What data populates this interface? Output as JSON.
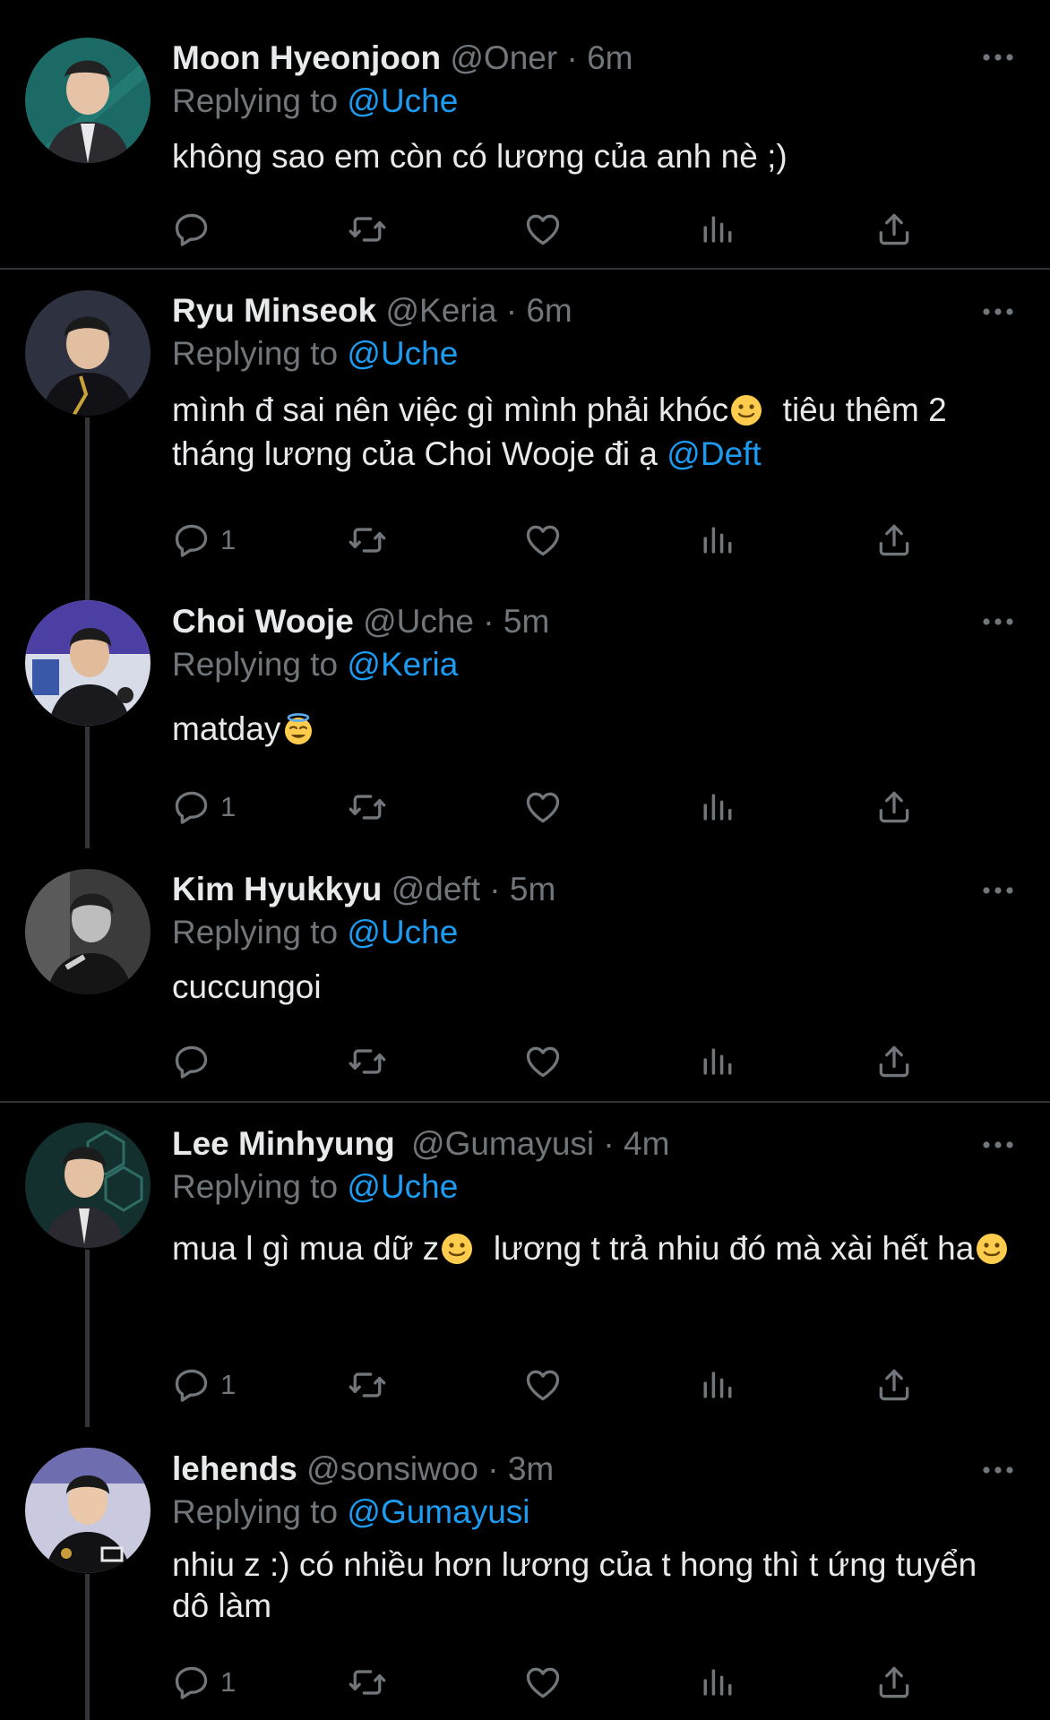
{
  "tweets": [
    {
      "name": "Moon Hyeonjoon",
      "handle": "@Oner",
      "sep": "·",
      "time": "6m",
      "replying_prefix": "Replying to",
      "replying_to": "@Uche",
      "body_text": "không sao em còn có lương của anh nè ;)",
      "reply_count": "",
      "avatar_color": "#2a6f6a"
    },
    {
      "name": "Ryu Minseok",
      "handle": "@Keria",
      "sep": "·",
      "time": "6m",
      "replying_prefix": "Replying to",
      "replying_to": "@Uche",
      "body_part1": "mình đ sai nên việc gì mình phải khóc",
      "body_part2": "  tiêu thêm 2 tháng lương của Choi Wooje đi ạ ",
      "body_mention": "@Deft",
      "reply_count": "1",
      "avatar_color": "#3a3d48"
    },
    {
      "name": "Choi Wooje",
      "handle": "@Uche",
      "sep": "·",
      "time": "5m",
      "replying_prefix": "Replying to",
      "replying_to": "@Keria",
      "body_text": "matday",
      "reply_count": "1",
      "avatar_color": "#4a4aa8"
    },
    {
      "name": "Kim Hyukkyu",
      "handle": "@deft",
      "sep": "·",
      "time": "5m",
      "replying_prefix": "Replying to",
      "replying_to": "@Uche",
      "body_text": "cuccungoi",
      "reply_count": "",
      "avatar_color": "#555555"
    },
    {
      "name": "Lee Minhyung",
      "handle": "@Gumayusi",
      "sep": "·",
      "time": "4m",
      "replying_prefix": "Replying to",
      "replying_to": "@Uche",
      "body_part1": "mua l gì mua dữ z",
      "body_part2": "  lương t trả nhiu đó mà xài hết ha",
      "reply_count": "1",
      "avatar_color": "#1f3a3a"
    },
    {
      "name": "lehends",
      "handle": "@sonsiwoo",
      "sep": "·",
      "time": "3m",
      "replying_prefix": "Replying to",
      "replying_to": "@Gumayusi",
      "body_text": "nhiu z :) có nhiều hơn lương của t hong thì t ứng tuyển dô làm",
      "reply_count": "1",
      "avatar_color": "#8a8ab8"
    }
  ],
  "icons": {
    "more": "more-icon",
    "reply": "reply-icon",
    "retweet": "retweet-icon",
    "like": "heart-icon",
    "views": "views-icon",
    "share": "share-icon"
  },
  "colors": {
    "background": "#000000",
    "text": "#e7e9ea",
    "muted": "#71767b",
    "link": "#1d9bf0",
    "divider": "#2f3336"
  }
}
